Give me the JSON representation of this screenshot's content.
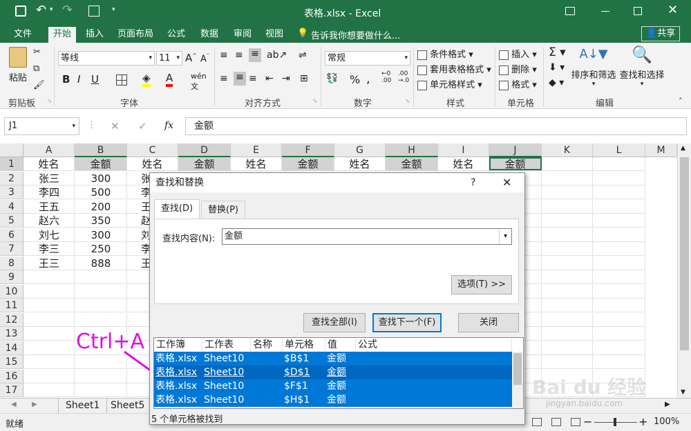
{
  "titlebar": {
    "title": "表格.xlsx - Excel",
    "share": "共享"
  },
  "tabs": [
    "文件",
    "开始",
    "插入",
    "页面布局",
    "公式",
    "数据",
    "审阅",
    "视图"
  ],
  "tell_me": "告诉我你想要做什么...",
  "ribbon": {
    "paste": "粘贴",
    "clipboard": "剪贴板",
    "font_name": "等线",
    "font_size": "11",
    "font_group": "字体",
    "bold": "B",
    "italic": "I",
    "underline": "U",
    "align_group": "对齐方式",
    "number_format": "常规",
    "number_group": "数字",
    "cond_format": "条件格式",
    "table_format": "套用表格格式",
    "cell_styles": "单元格样式",
    "styles_group": "样式",
    "insert": "插入",
    "delete": "删除",
    "format": "格式",
    "cells_group": "单元格",
    "sort_filter": "排序和筛选",
    "find_select": "查找和选择",
    "edit_group": "编辑"
  },
  "formula_bar": {
    "name_box": "J1",
    "content": "金额",
    "fx": "fx"
  },
  "grid": {
    "columns": [
      "A",
      "B",
      "C",
      "D",
      "E",
      "F",
      "G",
      "H",
      "I",
      "J",
      "K",
      "L",
      "M"
    ],
    "selected_columns": [
      "B",
      "D",
      "F",
      "H",
      "J"
    ],
    "rows": [
      "1",
      "2",
      "3",
      "4",
      "5",
      "6",
      "7",
      "8",
      "9",
      "10",
      "11",
      "12",
      "13",
      "14",
      "15",
      "16",
      "17"
    ],
    "header_row": [
      "姓名",
      "金额",
      "姓名",
      "金额",
      "姓名",
      "金额",
      "姓名",
      "金额",
      "姓名",
      "金额"
    ],
    "names": [
      "张三",
      "李四",
      "王五",
      "赵六",
      "刘七",
      "李三",
      "王三"
    ],
    "amounts": [
      "300",
      "500",
      "200",
      "350",
      "300",
      "250",
      "888"
    ],
    "col_c_partial": [
      "张",
      "李",
      "王",
      "赵",
      "刘",
      "李",
      "王"
    ]
  },
  "sheets": [
    "Sheet1",
    "Sheet5"
  ],
  "status": {
    "ready": "就绪",
    "zoom": "100%"
  },
  "dialog": {
    "title": "查找和替换",
    "help": "?",
    "tab_find": "查找(D)",
    "tab_replace": "替换(P)",
    "find_label": "查找内容(N):",
    "find_value": "金额",
    "options": "选项(T) >>",
    "find_all": "查找全部(I)",
    "find_next": "查找下一个(F)",
    "close": "关闭",
    "result_headers": [
      "工作簿",
      "工作表",
      "名称",
      "单元格",
      "值",
      "公式"
    ],
    "results": [
      {
        "book": "表格.xlsx",
        "sheet": "Sheet10",
        "cell": "$B$1",
        "value": "金额"
      },
      {
        "book": "表格.xlsx",
        "sheet": "Sheet10",
        "cell": "$D$1",
        "value": "金额"
      },
      {
        "book": "表格.xlsx",
        "sheet": "Sheet10",
        "cell": "$F$1",
        "value": "金额"
      },
      {
        "book": "表格.xlsx",
        "sheet": "Sheet10",
        "cell": "$H$1",
        "value": "金额"
      }
    ],
    "status": "5 个单元格被找到"
  },
  "annotation": "Ctrl+A",
  "watermark": {
    "brand": "Bai du 经验",
    "url": "jingyan.baidu.com"
  },
  "colors": {
    "excel_green": "#217346",
    "selection_blue": "#0078d7",
    "annotation": "#e010e0"
  }
}
